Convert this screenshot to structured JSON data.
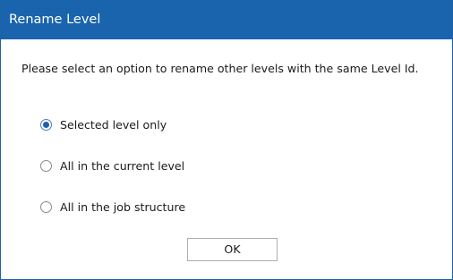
{
  "window": {
    "title": "Rename Level"
  },
  "prompt": "Please select an option to rename other levels with the same Level Id.",
  "options": [
    {
      "label": "Selected level only",
      "checked": true
    },
    {
      "label": "All in the current level",
      "checked": false
    },
    {
      "label": "All in the job structure",
      "checked": false
    }
  ],
  "buttons": {
    "ok_label": "OK"
  },
  "colors": {
    "titlebar": "#1964ad",
    "border": "#1a63a8"
  }
}
